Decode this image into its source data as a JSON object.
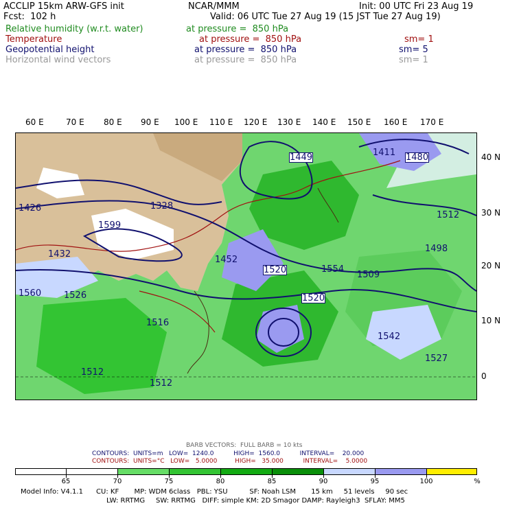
{
  "header": {
    "title_left": "ACCLIP 15km ARW-GFS init",
    "title_center": "NCAR/MMM",
    "init": "Init: 00 UTC Fri 23 Aug 19",
    "fcst": "Fcst:  102 h",
    "valid": "Valid: 06 UTC Tue 27 Aug 19 (15 JST Tue 27 Aug 19)"
  },
  "fields": [
    {
      "name": "Relative humidity (w.r.t. water)",
      "level": "at pressure =  850 hPa",
      "sm": "",
      "color": "#1f8b1f"
    },
    {
      "name": "Temperature",
      "level": "at pressure =  850 hPa",
      "sm": "sm= 1",
      "color": "#a01010"
    },
    {
      "name": "Geopotential height",
      "level": "at pressure =  850 hPa",
      "sm": "sm= 5",
      "color": "#10106e"
    },
    {
      "name": "Horizontal wind vectors",
      "level": "at pressure =  850 hPa",
      "sm": "sm= 1",
      "color": "#999999"
    }
  ],
  "lon_labels": [
    "60 E",
    "70 E",
    "80 E",
    "90 E",
    "100 E",
    "110 E",
    "120 E",
    "130 E",
    "140 E",
    "150 E",
    "160 E",
    "170 E"
  ],
  "lat_labels": [
    "40 N",
    "30 N",
    "20 N",
    "10 N",
    "0"
  ],
  "height_labels": [
    "1449",
    "1480",
    "1411",
    "1512",
    "1426",
    "1599",
    "1432",
    "1328",
    "1520",
    "1554",
    "1509",
    "1560",
    "1520",
    "1452",
    "1498",
    "1526",
    "1542",
    "1516",
    "1512",
    "1512",
    "1527"
  ],
  "footer": {
    "barb": "BARB VECTORS:  FULL BARB = 10 kts",
    "contours1": "CONTOURS:  UNITS=m   LOW=  1240.0          HIGH=  1560.0          INTERVAL=    20.000",
    "contours2": "CONTOURS:  UNITS=°C   LOW=   5.0000         HIGH=   35.000          INTERVAL=    5.0000",
    "colorbar_labels": [
      "65",
      "70",
      "75",
      "80",
      "85",
      "90",
      "95",
      "100",
      "%"
    ],
    "colorbar_colors": [
      "#ffffff",
      "#ffffff",
      "#66dd66",
      "#33c433",
      "#12aa12",
      "#0a8f0a",
      "#c8d8ff",
      "#9a9af0",
      "#ffee00"
    ],
    "model1": "Model Info: V4.1.1      CU: KF       MP: WDM 6class   PBL: YSU          SF: Noah LSM       15 km     51 levels     90 sec",
    "model2": "LW: RRTMG     SW: RRTMG   DIFF: simple KM: 2D Smagor DAMP: Rayleigh3  SFLAY: MM5"
  },
  "colors": {
    "rh_green": "#1f8b1f",
    "temp_red": "#a01010",
    "height_blue": "#10106e",
    "wind_gray": "#999999"
  }
}
